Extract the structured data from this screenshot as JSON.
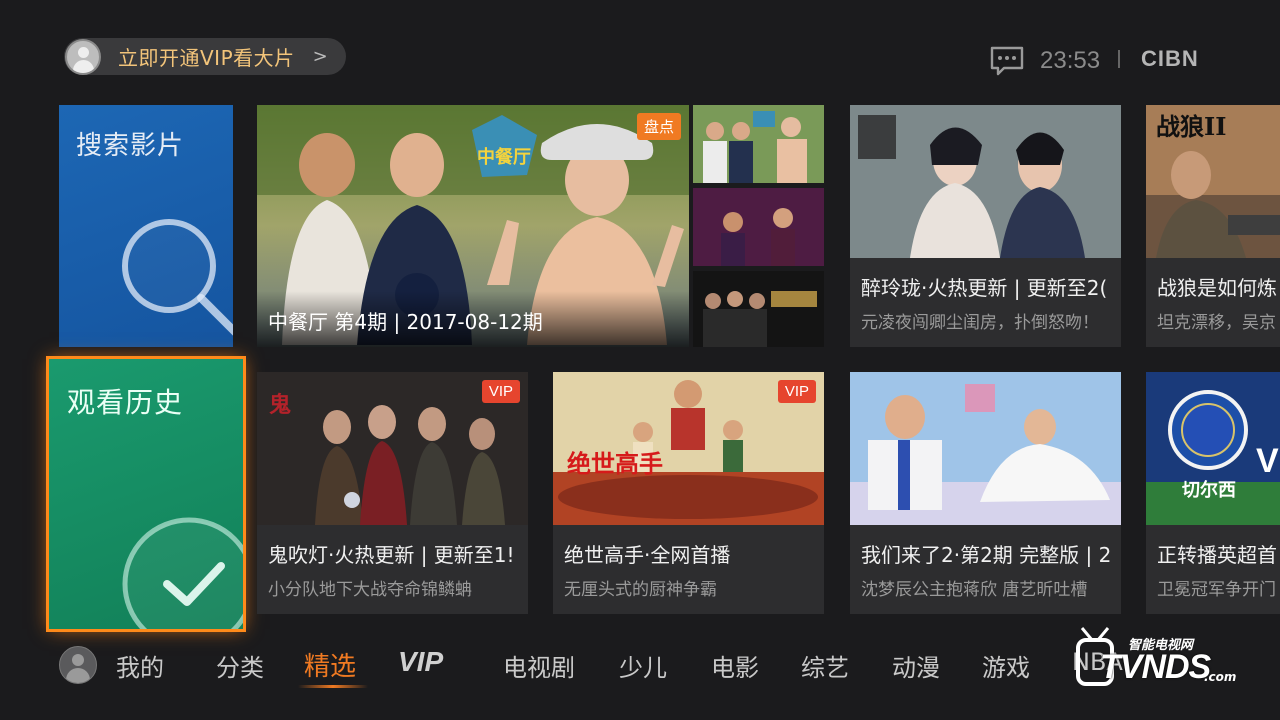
{
  "header": {
    "vip_promo": "立即开通VIP看大片",
    "vip_chevron": ">",
    "time": "23:53",
    "brand": "CIBN"
  },
  "tiles": {
    "search_label": "搜索影片",
    "history_label": "观看历史"
  },
  "featured": {
    "badge": "盘点",
    "caption": "中餐厅 第4期 | 2017-08-12期",
    "poster_logo": "中餐厅"
  },
  "cards_top": [
    {
      "title": "醉玲珑·火热更新 | 更新至2(",
      "subtitle": "元凌夜闯卿尘闺房，扑倒怒吻！"
    },
    {
      "title": "战狼是如何炼",
      "subtitle": "坦克漂移，吴京"
    }
  ],
  "cards_bottom": [
    {
      "badge": "VIP",
      "title": "鬼吹灯·火热更新 | 更新至1!",
      "subtitle": "小分队地下大战夺命锦鳞蚺"
    },
    {
      "badge": "VIP",
      "title": "绝世高手·全网首播",
      "subtitle": "无厘头式的厨神争霸"
    },
    {
      "title": "我们来了2·第2期 完整版 | 2",
      "subtitle": "沈梦辰公主抱蒋欣 唐艺昕吐槽"
    },
    {
      "title": "正转播英超首",
      "subtitle": "卫冕冠军争开门"
    }
  ],
  "nav": {
    "items": [
      "我的",
      "分类",
      "精选",
      "VIP",
      "电视剧",
      "少儿",
      "电影",
      "综艺",
      "动漫",
      "游戏",
      "NBA"
    ],
    "active_index": 2
  },
  "watermark": {
    "top": "智能电视网",
    "main": "TVNDS",
    "domain": ".com"
  },
  "colors": {
    "accent": "#f07a22",
    "vip_gold": "#f2c47a",
    "search_tile": "#1a5fae",
    "history_tile": "#16906a",
    "badge_red": "#e6452e"
  }
}
